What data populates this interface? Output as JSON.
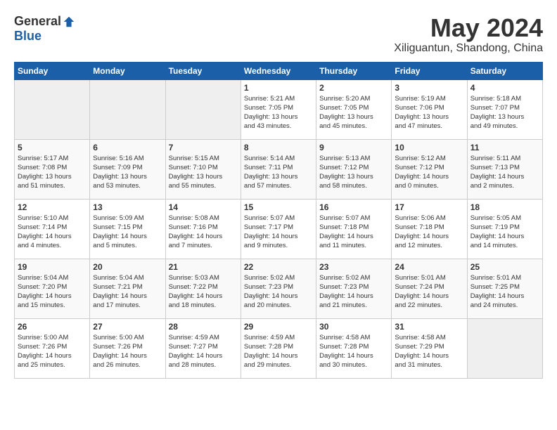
{
  "header": {
    "logo_general": "General",
    "logo_blue": "Blue",
    "month": "May 2024",
    "location": "Xiliguantun, Shandong, China"
  },
  "days_of_week": [
    "Sunday",
    "Monday",
    "Tuesday",
    "Wednesday",
    "Thursday",
    "Friday",
    "Saturday"
  ],
  "weeks": [
    {
      "days": [
        {
          "date": "",
          "info": ""
        },
        {
          "date": "",
          "info": ""
        },
        {
          "date": "",
          "info": ""
        },
        {
          "date": "1",
          "info": "Sunrise: 5:21 AM\nSunset: 7:05 PM\nDaylight: 13 hours\nand 43 minutes."
        },
        {
          "date": "2",
          "info": "Sunrise: 5:20 AM\nSunset: 7:05 PM\nDaylight: 13 hours\nand 45 minutes."
        },
        {
          "date": "3",
          "info": "Sunrise: 5:19 AM\nSunset: 7:06 PM\nDaylight: 13 hours\nand 47 minutes."
        },
        {
          "date": "4",
          "info": "Sunrise: 5:18 AM\nSunset: 7:07 PM\nDaylight: 13 hours\nand 49 minutes."
        }
      ]
    },
    {
      "days": [
        {
          "date": "5",
          "info": "Sunrise: 5:17 AM\nSunset: 7:08 PM\nDaylight: 13 hours\nand 51 minutes."
        },
        {
          "date": "6",
          "info": "Sunrise: 5:16 AM\nSunset: 7:09 PM\nDaylight: 13 hours\nand 53 minutes."
        },
        {
          "date": "7",
          "info": "Sunrise: 5:15 AM\nSunset: 7:10 PM\nDaylight: 13 hours\nand 55 minutes."
        },
        {
          "date": "8",
          "info": "Sunrise: 5:14 AM\nSunset: 7:11 PM\nDaylight: 13 hours\nand 57 minutes."
        },
        {
          "date": "9",
          "info": "Sunrise: 5:13 AM\nSunset: 7:12 PM\nDaylight: 13 hours\nand 58 minutes."
        },
        {
          "date": "10",
          "info": "Sunrise: 5:12 AM\nSunset: 7:12 PM\nDaylight: 14 hours\nand 0 minutes."
        },
        {
          "date": "11",
          "info": "Sunrise: 5:11 AM\nSunset: 7:13 PM\nDaylight: 14 hours\nand 2 minutes."
        }
      ]
    },
    {
      "days": [
        {
          "date": "12",
          "info": "Sunrise: 5:10 AM\nSunset: 7:14 PM\nDaylight: 14 hours\nand 4 minutes."
        },
        {
          "date": "13",
          "info": "Sunrise: 5:09 AM\nSunset: 7:15 PM\nDaylight: 14 hours\nand 5 minutes."
        },
        {
          "date": "14",
          "info": "Sunrise: 5:08 AM\nSunset: 7:16 PM\nDaylight: 14 hours\nand 7 minutes."
        },
        {
          "date": "15",
          "info": "Sunrise: 5:07 AM\nSunset: 7:17 PM\nDaylight: 14 hours\nand 9 minutes."
        },
        {
          "date": "16",
          "info": "Sunrise: 5:07 AM\nSunset: 7:18 PM\nDaylight: 14 hours\nand 11 minutes."
        },
        {
          "date": "17",
          "info": "Sunrise: 5:06 AM\nSunset: 7:18 PM\nDaylight: 14 hours\nand 12 minutes."
        },
        {
          "date": "18",
          "info": "Sunrise: 5:05 AM\nSunset: 7:19 PM\nDaylight: 14 hours\nand 14 minutes."
        }
      ]
    },
    {
      "days": [
        {
          "date": "19",
          "info": "Sunrise: 5:04 AM\nSunset: 7:20 PM\nDaylight: 14 hours\nand 15 minutes."
        },
        {
          "date": "20",
          "info": "Sunrise: 5:04 AM\nSunset: 7:21 PM\nDaylight: 14 hours\nand 17 minutes."
        },
        {
          "date": "21",
          "info": "Sunrise: 5:03 AM\nSunset: 7:22 PM\nDaylight: 14 hours\nand 18 minutes."
        },
        {
          "date": "22",
          "info": "Sunrise: 5:02 AM\nSunset: 7:23 PM\nDaylight: 14 hours\nand 20 minutes."
        },
        {
          "date": "23",
          "info": "Sunrise: 5:02 AM\nSunset: 7:23 PM\nDaylight: 14 hours\nand 21 minutes."
        },
        {
          "date": "24",
          "info": "Sunrise: 5:01 AM\nSunset: 7:24 PM\nDaylight: 14 hours\nand 22 minutes."
        },
        {
          "date": "25",
          "info": "Sunrise: 5:01 AM\nSunset: 7:25 PM\nDaylight: 14 hours\nand 24 minutes."
        }
      ]
    },
    {
      "days": [
        {
          "date": "26",
          "info": "Sunrise: 5:00 AM\nSunset: 7:26 PM\nDaylight: 14 hours\nand 25 minutes."
        },
        {
          "date": "27",
          "info": "Sunrise: 5:00 AM\nSunset: 7:26 PM\nDaylight: 14 hours\nand 26 minutes."
        },
        {
          "date": "28",
          "info": "Sunrise: 4:59 AM\nSunset: 7:27 PM\nDaylight: 14 hours\nand 28 minutes."
        },
        {
          "date": "29",
          "info": "Sunrise: 4:59 AM\nSunset: 7:28 PM\nDaylight: 14 hours\nand 29 minutes."
        },
        {
          "date": "30",
          "info": "Sunrise: 4:58 AM\nSunset: 7:28 PM\nDaylight: 14 hours\nand 30 minutes."
        },
        {
          "date": "31",
          "info": "Sunrise: 4:58 AM\nSunset: 7:29 PM\nDaylight: 14 hours\nand 31 minutes."
        },
        {
          "date": "",
          "info": ""
        }
      ]
    }
  ]
}
